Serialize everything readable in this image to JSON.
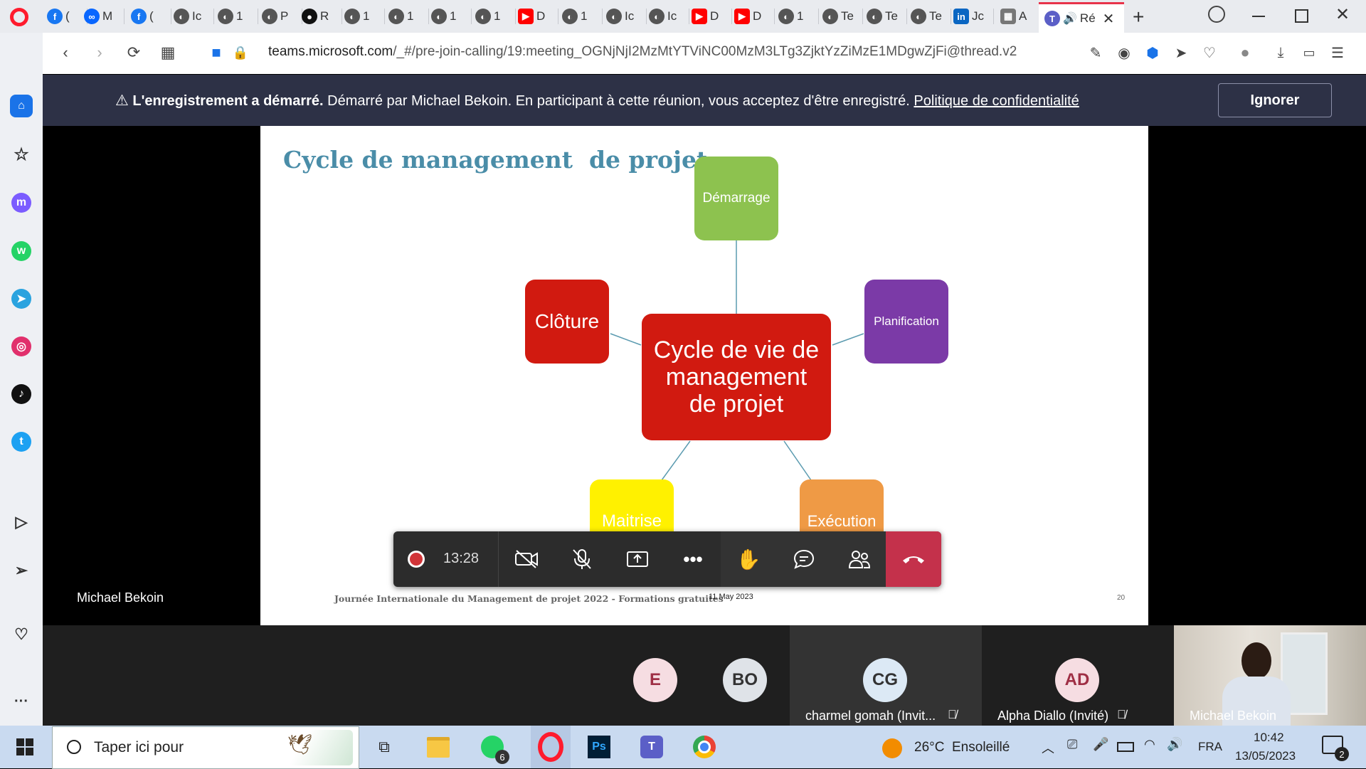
{
  "browser": {
    "tabs": [
      {
        "icon": "facebook-icon",
        "label": "("
      },
      {
        "icon": "meta-icon",
        "label": "M"
      },
      {
        "icon": "facebook-icon",
        "label": "("
      },
      {
        "icon": "globe-icon",
        "label": "Ic"
      },
      {
        "icon": "globe-icon",
        "label": "1"
      },
      {
        "icon": "globe-icon",
        "label": "P"
      },
      {
        "icon": "github-icon",
        "label": "R"
      },
      {
        "icon": "globe-icon",
        "label": "1"
      },
      {
        "icon": "globe-icon",
        "label": "1"
      },
      {
        "icon": "globe-icon",
        "label": "1"
      },
      {
        "icon": "globe-icon",
        "label": "1"
      },
      {
        "icon": "youtube-icon",
        "label": "D"
      },
      {
        "icon": "globe-icon",
        "label": "1"
      },
      {
        "icon": "globe-icon",
        "label": "Ic"
      },
      {
        "icon": "globe-icon",
        "label": "Ic"
      },
      {
        "icon": "youtube-icon",
        "label": "D"
      },
      {
        "icon": "youtube-icon",
        "label": "D"
      },
      {
        "icon": "globe-icon",
        "label": "1"
      },
      {
        "icon": "globe-icon",
        "label": "Te"
      },
      {
        "icon": "globe-icon",
        "label": "Te"
      },
      {
        "icon": "globe-icon",
        "label": "Te"
      },
      {
        "icon": "linkedin-icon",
        "label": "Jc"
      },
      {
        "icon": "apps-icon",
        "label": "A"
      }
    ],
    "active_tab": {
      "icon": "teams-icon",
      "label": "Ré"
    },
    "url_domain": "teams.microsoft.com",
    "url_path": "/_#/pre-join-calling/19:meeting_OGNjNjI2MzMtYTViNC00MzM3LTg3ZjktYzZiMzE1MDgwZjFi@thread.v2"
  },
  "banner": {
    "title": "L'enregistrement a démarré.",
    "message": "Démarré par Michael Bekoin. En participant à cette réunion, vous acceptez d'être enregistré.",
    "link": "Politique de confidentialité",
    "ignore_label": "Ignorer"
  },
  "slide": {
    "title": "Cycle de management  de projet",
    "center": "Cycle de vie de management de projet",
    "nodes": {
      "demarrage": "Démarrage",
      "planification": "Planification",
      "execution": "Exécution",
      "maitrise": "Maitrise",
      "cloture": "Clôture"
    },
    "footer": "Journée Internationale du Management de projet 2022 - Formations gratuites",
    "date": "11 May 2023",
    "page": "20",
    "colors": {
      "title": "#4a8da8",
      "demarrage": "#8dc24f",
      "planification": "#7b3aa7",
      "execution": "#ef9a45",
      "maitrise": "#fff100",
      "cloture": "#d11a10",
      "center": "#d11a10"
    }
  },
  "presenter": "Michael Bekoin",
  "controls": {
    "timer": "13:28"
  },
  "participants": [
    {
      "initials": "E",
      "name": ""
    },
    {
      "initials": "BO",
      "name": ""
    },
    {
      "initials": "CG",
      "name": "charmel gomah (Invit..."
    },
    {
      "initials": "AD",
      "name": "Alpha Diallo (Invité)"
    }
  ],
  "video_name": "Michael Bekoin",
  "taskbar": {
    "search_placeholder": "Taper ici pour",
    "whatsapp_badge": "6",
    "weather": "26°C  Ensoleillé",
    "lang": "FRA",
    "time": "10:42",
    "date": "13/05/2023",
    "notif_count": "2"
  }
}
